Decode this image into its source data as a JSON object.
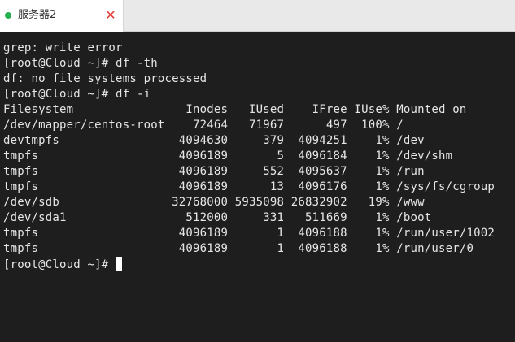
{
  "tab": {
    "title": "服务器2",
    "status_color": "#22b14c",
    "close_glyph": "✕"
  },
  "terminal": {
    "lines": [
      "grep: write error",
      "[root@Cloud ~]# df -th",
      "df: no file systems processed",
      "[root@Cloud ~]# df -i",
      "Filesystem                Inodes   IUsed    IFree IUse% Mounted on",
      "/dev/mapper/centos-root    72464   71967      497  100% /",
      "devtmpfs                 4094630     379  4094251    1% /dev",
      "tmpfs                    4096189       5  4096184    1% /dev/shm",
      "tmpfs                    4096189     552  4095637    1% /run",
      "tmpfs                    4096189      13  4096176    1% /sys/fs/cgroup",
      "/dev/sdb                32768000 5935098 26832902   19% /www",
      "/dev/sda1                 512000     331   511669    1% /boot",
      "tmpfs                    4096189       1  4096188    1% /run/user/1002",
      "tmpfs                    4096189       1  4096188    1% /run/user/0"
    ],
    "prompt": "[root@Cloud ~]# "
  }
}
